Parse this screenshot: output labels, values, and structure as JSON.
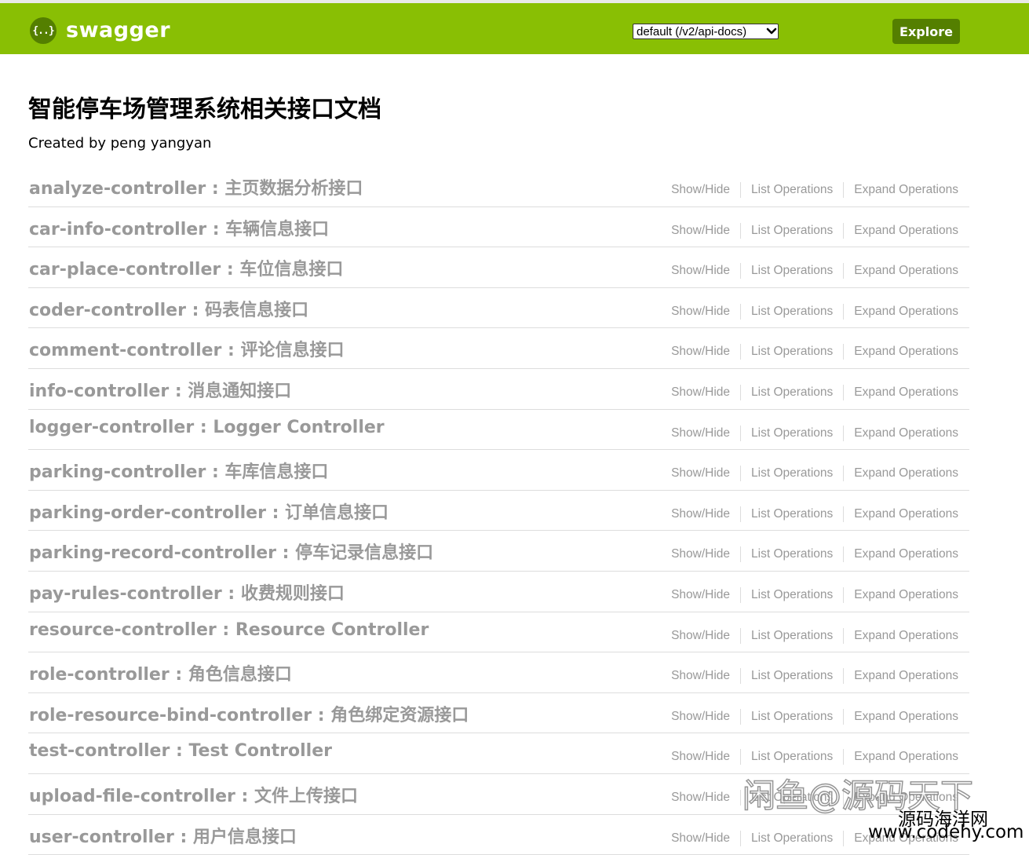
{
  "header": {
    "logo_icon_text": "{..}",
    "logo_text": "swagger",
    "api_select_value": "default (/v2/api-docs)",
    "explore_label": "Explore",
    "colors": {
      "header_bg": "#89bf04",
      "dark_green": "#547f00"
    }
  },
  "info": {
    "title": "智能停车场管理系统相关接口文档",
    "subtitle": "Created by peng yangyan"
  },
  "actions": {
    "show_hide": "Show/Hide",
    "list_operations": "List Operations",
    "expand_operations": "Expand Operations"
  },
  "resources": [
    {
      "title": "analyze-controller : 主页数据分析接口"
    },
    {
      "title": "car-info-controller : 车辆信息接口"
    },
    {
      "title": "car-place-controller : 车位信息接口"
    },
    {
      "title": "coder-controller : 码表信息接口"
    },
    {
      "title": "comment-controller : 评论信息接口"
    },
    {
      "title": "info-controller : 消息通知接口"
    },
    {
      "title": "logger-controller : Logger Controller"
    },
    {
      "title": "parking-controller : 车库信息接口"
    },
    {
      "title": "parking-order-controller : 订单信息接口"
    },
    {
      "title": "parking-record-controller : 停车记录信息接口"
    },
    {
      "title": "pay-rules-controller : 收费规则接口"
    },
    {
      "title": "resource-controller : Resource Controller"
    },
    {
      "title": "role-controller : 角色信息接口"
    },
    {
      "title": "role-resource-bind-controller : 角色绑定资源接口"
    },
    {
      "title": "test-controller : Test Controller"
    },
    {
      "title": "upload-file-controller : 文件上传接口"
    },
    {
      "title": "user-controller : 用户信息接口"
    }
  ],
  "watermarks": {
    "line1": "闲鱼@源码天下",
    "line2": "源码海洋网",
    "line3": "www.codehy.com"
  }
}
